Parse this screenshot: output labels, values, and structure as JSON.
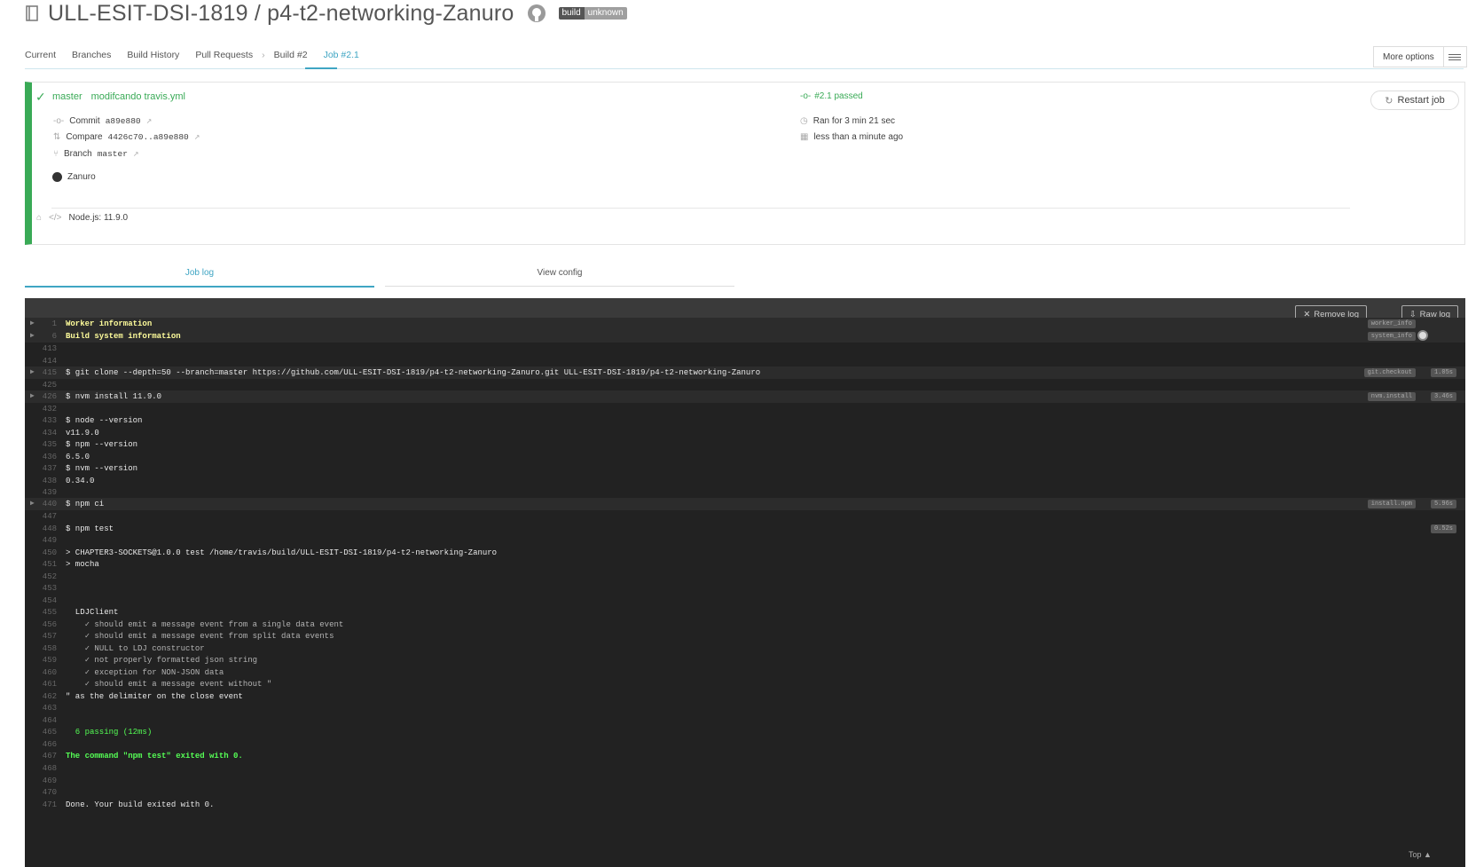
{
  "header": {
    "repo_title": "ULL-ESIT-DSI-1819 / p4-t2-networking-Zanuro",
    "badge_left": "build",
    "badge_right": "unknown"
  },
  "tabs": [
    "Current",
    "Branches",
    "Build History",
    "Pull Requests",
    "Build #2",
    "Job #2.1"
  ],
  "more_options": "More options",
  "job": {
    "branch": "master",
    "message": "modifcando travis.yml",
    "commit_label": "Commit",
    "commit": "a89e880",
    "compare_label": "Compare",
    "compare": "4426c70..a89e880",
    "branch_label": "Branch",
    "branch_value": "master",
    "author": "Zanuro",
    "status": "#2.1 passed",
    "duration": "Ran for 3 min 21 sec",
    "finished": "less than a minute ago",
    "restart": "Restart job",
    "language": "Node.js: 11.9.0"
  },
  "subtabs": {
    "log": "Job log",
    "config": "View config"
  },
  "log_buttons": {
    "remove": "Remove log",
    "raw": "Raw log"
  },
  "log_lines": [
    {
      "n": "1",
      "t": "Worker information",
      "cls": "yel",
      "fold": true,
      "tag": "worker_info"
    },
    {
      "n": "6",
      "t": "Build system information",
      "cls": "yel",
      "fold": true,
      "tag": "system_info"
    },
    {
      "n": "413",
      "t": ""
    },
    {
      "n": "414",
      "t": ""
    },
    {
      "n": "415",
      "t": "$ git clone --depth=50 --branch=master https://github.com/ULL-ESIT-DSI-1819/p4-t2-networking-Zanuro.git ULL-ESIT-DSI-1819/p4-t2-networking-Zanuro",
      "fold": true,
      "tag": "git.checkout",
      "time": "1.05s"
    },
    {
      "n": "425",
      "t": ""
    },
    {
      "n": "426",
      "t": "$ nvm install 11.9.0",
      "fold": true,
      "tag": "nvm.install",
      "time": "3.46s"
    },
    {
      "n": "432",
      "t": ""
    },
    {
      "n": "433",
      "t": "$ node --version"
    },
    {
      "n": "434",
      "t": "v11.9.0"
    },
    {
      "n": "435",
      "t": "$ npm --version"
    },
    {
      "n": "436",
      "t": "6.5.0"
    },
    {
      "n": "437",
      "t": "$ nvm --version"
    },
    {
      "n": "438",
      "t": "0.34.0"
    },
    {
      "n": "439",
      "t": ""
    },
    {
      "n": "440",
      "t": "$ npm ci",
      "fold": true,
      "tag": "install.npm",
      "time": "5.96s"
    },
    {
      "n": "447",
      "t": ""
    },
    {
      "n": "448",
      "t": "$ npm test",
      "time": "0.52s"
    },
    {
      "n": "449",
      "t": ""
    },
    {
      "n": "450",
      "t": "> CHAPTER3-SOCKETS@1.0.0 test /home/travis/build/ULL-ESIT-DSI-1819/p4-t2-networking-Zanuro"
    },
    {
      "n": "451",
      "t": "> mocha"
    },
    {
      "n": "452",
      "t": ""
    },
    {
      "n": "453",
      "t": ""
    },
    {
      "n": "454",
      "t": ""
    },
    {
      "n": "455",
      "t": "  LDJClient"
    },
    {
      "n": "456",
      "t": "    ✓ should emit a message event from a single data event",
      "cls": "dim"
    },
    {
      "n": "457",
      "t": "    ✓ should emit a message event from split data events",
      "cls": "dim"
    },
    {
      "n": "458",
      "t": "    ✓ NULL to LDJ constructor",
      "cls": "dim"
    },
    {
      "n": "459",
      "t": "    ✓ not properly formatted json string",
      "cls": "dim"
    },
    {
      "n": "460",
      "t": "    ✓ exception for NON-JSON data",
      "cls": "dim"
    },
    {
      "n": "461",
      "t": "    ✓ should emit a message event without \"",
      "cls": "dim"
    },
    {
      "n": "462",
      "t": "\" as the delimiter on the close event"
    },
    {
      "n": "463",
      "t": ""
    },
    {
      "n": "464",
      "t": ""
    },
    {
      "n": "465",
      "t": "  6 passing (12ms)",
      "cls": "grn"
    },
    {
      "n": "466",
      "t": ""
    },
    {
      "n": "467",
      "t": "The command \"npm test\" exited with 0.",
      "cls": "bgrn"
    },
    {
      "n": "468",
      "t": ""
    },
    {
      "n": "469",
      "t": ""
    },
    {
      "n": "470",
      "t": ""
    },
    {
      "n": "471",
      "t": "Done. Your build exited with 0."
    }
  ],
  "top_link": "Top"
}
